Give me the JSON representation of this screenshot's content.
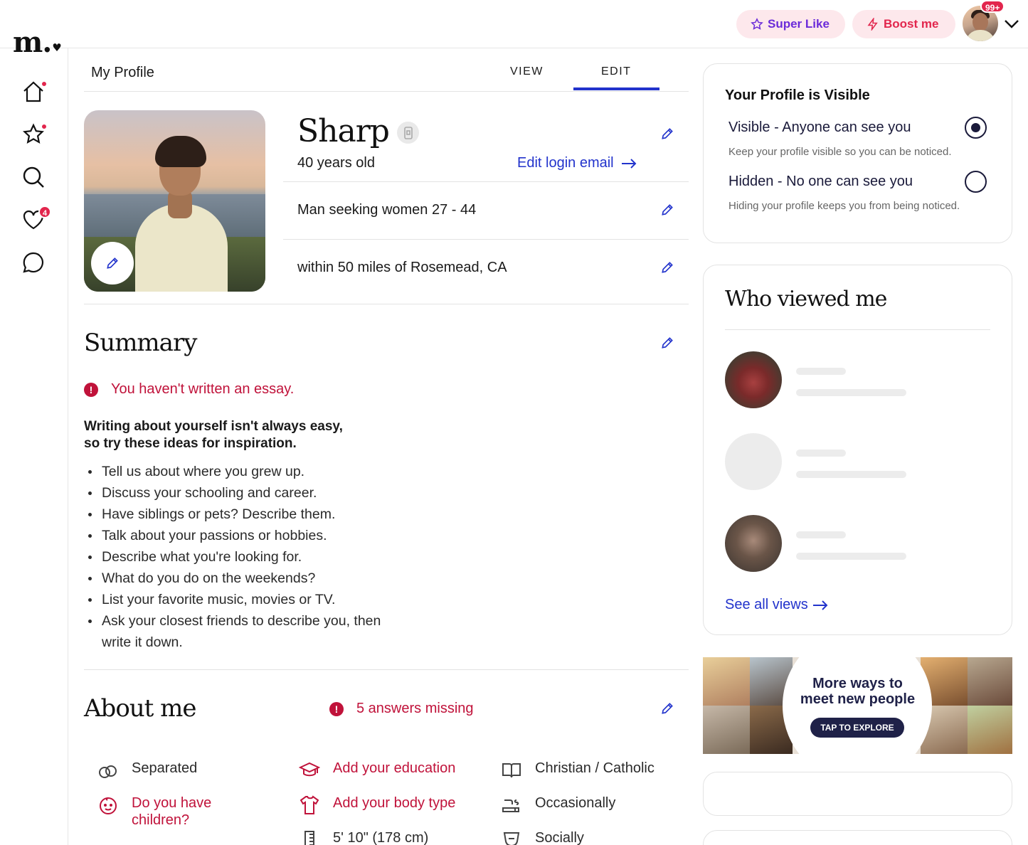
{
  "topbar": {
    "logo": "m.",
    "super_like_label": "Super Like",
    "boost_label": "Boost me",
    "notification_count": "99+"
  },
  "leftnav": {
    "items": [
      {
        "icon": "home-icon",
        "has_dot": true
      },
      {
        "icon": "star-icon",
        "has_dot": true
      },
      {
        "icon": "search-icon",
        "has_dot": false
      },
      {
        "icon": "heart-icon",
        "badge": "4"
      },
      {
        "icon": "chat-icon",
        "has_dot": false
      }
    ]
  },
  "header": {
    "title": "My Profile",
    "tabs": [
      {
        "label": "VIEW"
      },
      {
        "label": "EDIT"
      }
    ],
    "active_tab": "EDIT"
  },
  "profile": {
    "name": "Sharp",
    "age": "40 years old",
    "edit_login_email": "Edit login email",
    "seeking": "Man seeking women 27 - 44",
    "location": "within 50 miles of Rosemead, CA"
  },
  "summary": {
    "heading": "Summary",
    "warning": "You haven't written an essay.",
    "inspiration_line1": "Writing about yourself isn't always easy,",
    "inspiration_line2": "so try these ideas for inspiration.",
    "tips": [
      "Tell us about where you grew up.",
      "Discuss your schooling and career.",
      "Have siblings or pets? Describe them.",
      "Talk about your passions or hobbies.",
      "Describe what you're looking for.",
      "What do you do on the weekends?",
      "List your favorite music, movies or TV.",
      "Ask your closest friends to describe you, then write it down."
    ]
  },
  "about": {
    "heading": "About me",
    "missing": "5 answers missing",
    "items": [
      {
        "label": "Separated",
        "icon": "rings-icon",
        "missing": false
      },
      {
        "label": "Add your education",
        "icon": "graduation-cap-icon",
        "missing": true
      },
      {
        "label": "Christian / Catholic",
        "icon": "book-icon",
        "missing": false
      },
      {
        "label": "Do you have children?",
        "icon": "baby-face-icon",
        "missing": true
      },
      {
        "label": "Add your body type",
        "icon": "shirt-icon",
        "missing": true
      },
      {
        "label": "Occasionally",
        "icon": "smoking-icon",
        "missing": false
      },
      {
        "label": "5' 10\" (178 cm)",
        "icon": "ruler-icon",
        "missing": false
      },
      {
        "label": "Socially",
        "icon": "drink-icon",
        "missing": false
      }
    ]
  },
  "visibility": {
    "title": "Your Profile is Visible",
    "options": [
      {
        "label": "Visible - Anyone can see you",
        "desc": "Keep your profile visible so you can be noticed.",
        "selected": true
      },
      {
        "label": "Hidden - No one can see you",
        "desc": "Hiding your profile keeps you from being noticed.",
        "selected": false
      }
    ]
  },
  "who_viewed": {
    "title": "Who viewed me",
    "see_all": "See all views"
  },
  "promo": {
    "text": "More ways to meet new people",
    "button": "TAP TO EXPLORE"
  },
  "colors": {
    "accent_blue": "#2233cc",
    "alert_red": "#c0123a",
    "pink_bg": "#fde8ec",
    "navy": "#1f2148"
  }
}
